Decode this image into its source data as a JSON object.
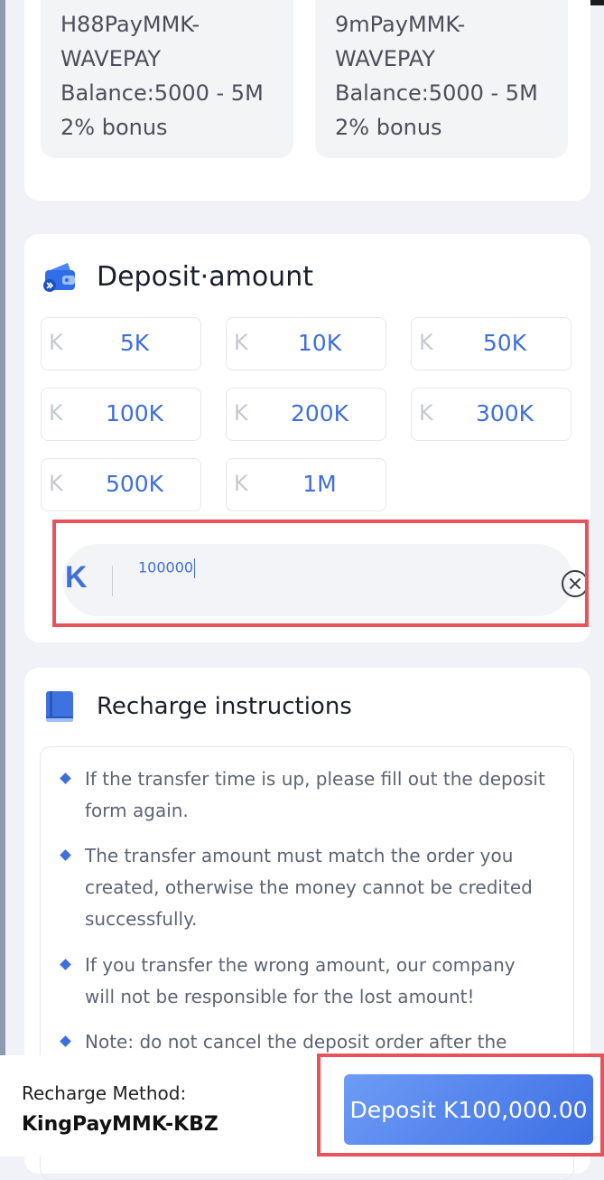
{
  "channels": [
    {
      "name_line1": "H88PayMMK-",
      "name_line2": "WAVEPAY",
      "balance": "Balance:5000 - 5M",
      "bonus": "2% bonus"
    },
    {
      "name_line1": "9mPayMMK-",
      "name_line2": "WAVEPAY",
      "balance": "Balance:5000 - 5M",
      "bonus": "2% bonus"
    }
  ],
  "deposit": {
    "title": "Deposit·amount",
    "currency_symbol": "K",
    "amounts": [
      "5K",
      "10K",
      "50K",
      "100K",
      "200K",
      "300K",
      "500K",
      "1M"
    ],
    "custom_value": "100000"
  },
  "instructions": {
    "title": "Recharge instructions",
    "items": [
      "If the transfer time is up, please fill out the deposit form again.",
      "The transfer amount must match the order you created, otherwise the money cannot be credited successfully.",
      "If you transfer the wrong amount, our company will not be responsible for the lost amount!",
      "Note: do not cancel the deposit order after the"
    ]
  },
  "footer": {
    "method_label": "Recharge Method:",
    "method_value": "KingPayMMK-KBZ",
    "deposit_button": "Deposit K100,000.00"
  },
  "colors": {
    "accent": "#3f6fd8",
    "highlight": "#e8525a"
  },
  "icons": {
    "deposit": "wallet-icon",
    "instructions": "book-icon",
    "clear": "clear-circle-icon"
  }
}
